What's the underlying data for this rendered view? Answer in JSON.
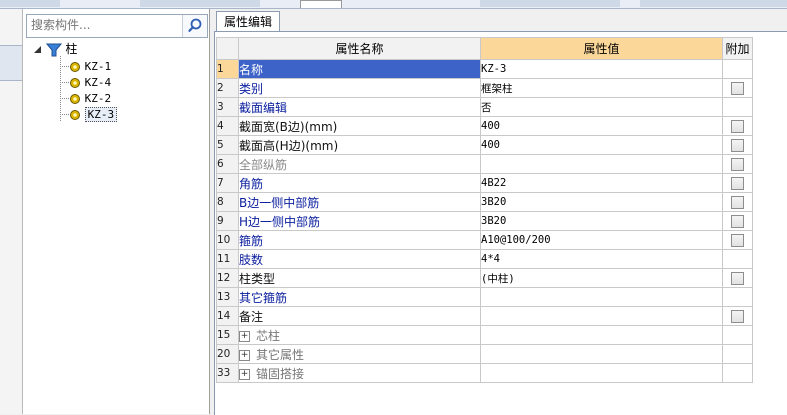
{
  "colors": {
    "accent": "#fbd89a",
    "selection": "#3d62c8",
    "link_blue": "#0a1e9e"
  },
  "sidebar": {
    "search_placeholder": "搜索构件...",
    "tree": {
      "root_label": "柱",
      "children": [
        "KZ-1",
        "KZ-4",
        "KZ-2",
        "KZ-3"
      ],
      "selected": "KZ-3"
    }
  },
  "tabs": [
    {
      "label": "属性编辑"
    }
  ],
  "table": {
    "headers": {
      "name": "属性名称",
      "value": "属性值",
      "extra": "附加"
    },
    "rows": [
      {
        "num": "1",
        "name": "名称",
        "value": "KZ-3",
        "checkbox": false,
        "style": "selrow"
      },
      {
        "num": "2",
        "name": "类别",
        "value": "框架柱",
        "checkbox": true,
        "style": "blue"
      },
      {
        "num": "3",
        "name": "截面编辑",
        "value": "否",
        "checkbox": false,
        "style": "blue"
      },
      {
        "num": "4",
        "name": "截面宽(B边)(mm)",
        "value": "400",
        "checkbox": true,
        "style": "black"
      },
      {
        "num": "5",
        "name": "截面高(H边)(mm)",
        "value": "400",
        "checkbox": true,
        "style": "black"
      },
      {
        "num": "6",
        "name": "全部纵筋",
        "value": "",
        "checkbox": true,
        "style": "gray"
      },
      {
        "num": "7",
        "name": "角筋",
        "value": "4B22",
        "checkbox": true,
        "style": "blue"
      },
      {
        "num": "8",
        "name": "B边一侧中部筋",
        "value": "3B20",
        "checkbox": true,
        "style": "blue"
      },
      {
        "num": "9",
        "name": "H边一侧中部筋",
        "value": "3B20",
        "checkbox": true,
        "style": "blue"
      },
      {
        "num": "10",
        "name": "箍筋",
        "value": "A10@100/200",
        "checkbox": true,
        "style": "blue"
      },
      {
        "num": "11",
        "name": "肢数",
        "value": "4*4",
        "checkbox": false,
        "style": "blue"
      },
      {
        "num": "12",
        "name": "柱类型",
        "value": "(中柱)",
        "checkbox": true,
        "style": "black"
      },
      {
        "num": "13",
        "name": "其它箍筋",
        "value": "",
        "checkbox": false,
        "style": "blue"
      },
      {
        "num": "14",
        "name": "备注",
        "value": "",
        "checkbox": true,
        "style": "black"
      }
    ],
    "groups": [
      {
        "num": "15",
        "name": "芯柱"
      },
      {
        "num": "20",
        "name": "其它属性"
      },
      {
        "num": "33",
        "name": "锚固搭接"
      }
    ]
  }
}
